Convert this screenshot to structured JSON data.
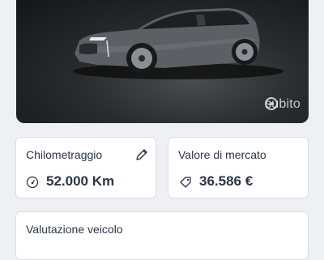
{
  "hero": {
    "watermark": "subito",
    "colors": {
      "background": "#1c1d1f",
      "car_body": "#5c5f63"
    }
  },
  "cards": {
    "mileage": {
      "label": "Chilometraggio",
      "value": "52.000 Km",
      "icon": "odometer-icon",
      "action_icon": "pencil-icon"
    },
    "market_value": {
      "label": "Valore di mercato",
      "value": "36.586 €",
      "icon": "price-tag-icon"
    },
    "valuation": {
      "label": "Valutazione veicolo"
    }
  }
}
